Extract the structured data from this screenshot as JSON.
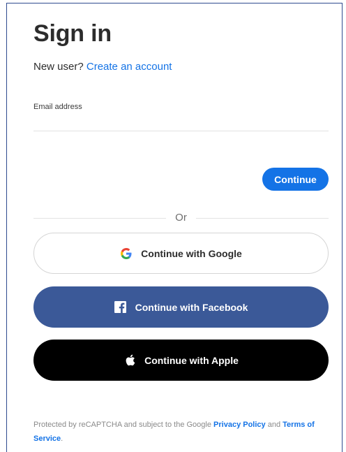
{
  "signin": {
    "title": "Sign in",
    "new_user_prefix": "New user?",
    "create_account_link": "Create an account",
    "email_label": "Email address",
    "email_value": "",
    "continue_label": "Continue",
    "divider_text": "Or"
  },
  "social": {
    "google_label": "Continue with Google",
    "facebook_label": "Continue with Facebook",
    "apple_label": "Continue with Apple"
  },
  "footer": {
    "text_before": "Protected by reCAPTCHA and subject to the Google",
    "privacy_link": "Privacy Policy",
    "and": "and",
    "terms_link": "Terms of Service",
    "period": "."
  },
  "colors": {
    "accent": "#1473e6",
    "facebook": "#3b5998",
    "apple": "#000000",
    "frame_border": "#2e4b8f"
  }
}
